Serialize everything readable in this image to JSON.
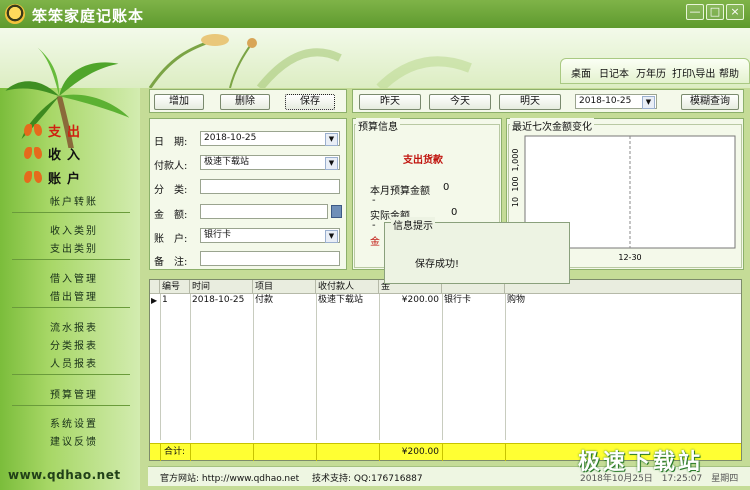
{
  "window": {
    "title": "笨笨家庭记账本",
    "min_btn": "—",
    "max_btn": "□",
    "close_btn": "×"
  },
  "topnav": [
    "桌面",
    "日记本",
    "万年历",
    "打印\\导出",
    "帮助"
  ],
  "sidebar": {
    "main": [
      {
        "label": "支出",
        "active": true
      },
      {
        "label": "收入",
        "active": false
      },
      {
        "label": "账户",
        "active": false
      }
    ],
    "groups": [
      [
        "帐户转账"
      ],
      [
        "收入类别",
        "支出类别"
      ],
      [
        "借入管理",
        "借出管理"
      ],
      [
        "流水报表",
        "分类报表",
        "人员报表"
      ],
      [
        "预算管理"
      ],
      [
        "系统设置",
        "建议反馈"
      ]
    ],
    "website": "www.qdhao.net"
  },
  "toolbar": {
    "add": "增加",
    "delete": "删除",
    "save": "保存",
    "yesterday": "昨天",
    "today": "今天",
    "tomorrow": "明天",
    "date_value": "2018-10-25",
    "fuzzy_search": "模糊查询"
  },
  "form": {
    "date_label": "日　期:",
    "date_value": "2018-10-25",
    "payee_label": "付款人:",
    "payee_value": "极速下载站",
    "category_label": "分　类:",
    "category_value": "",
    "amount_label": "金　额:",
    "amount_value": "",
    "account_label": "账　户:",
    "account_value": "银行卡",
    "note_label": "备　注:",
    "note_value": ""
  },
  "budget": {
    "title": "预算信息",
    "heading": "支出货款",
    "line1_label": "本月预算金额",
    "line1_value": "0",
    "dash1": "-",
    "line2_label": "实际金额",
    "line2_value": "0",
    "dash2": "-",
    "line3_label": "金"
  },
  "chart_data": {
    "type": "line",
    "title": "最近七次金额变化",
    "y_tick_labels": [
      "1,000",
      "100",
      "10"
    ],
    "x_tick_labels": [
      "12-30"
    ],
    "series": []
  },
  "table": {
    "columns": [
      "编号",
      "时间",
      "项目",
      "收付款人",
      "金",
      "",
      ""
    ],
    "rows": [
      [
        "1",
        "2018-10-25",
        "付款",
        "极速下载站",
        "¥200.00",
        "银行卡",
        "购物"
      ]
    ],
    "total_label": "合计:",
    "total_value": "¥200.00"
  },
  "status": {
    "website": "官方网站: http://www.qdhao.net",
    "support": "技术支持: QQ:176716887",
    "datetime": "2018年10月25日　17:25:07　星期四"
  },
  "dialog": {
    "title": "信息提示",
    "message": "保存成功!"
  },
  "watermark": "极速下载站",
  "colors": {
    "accent_green": "#6aa533",
    "total_yellow": "#ffff33",
    "heading_red": "#c0150f"
  }
}
